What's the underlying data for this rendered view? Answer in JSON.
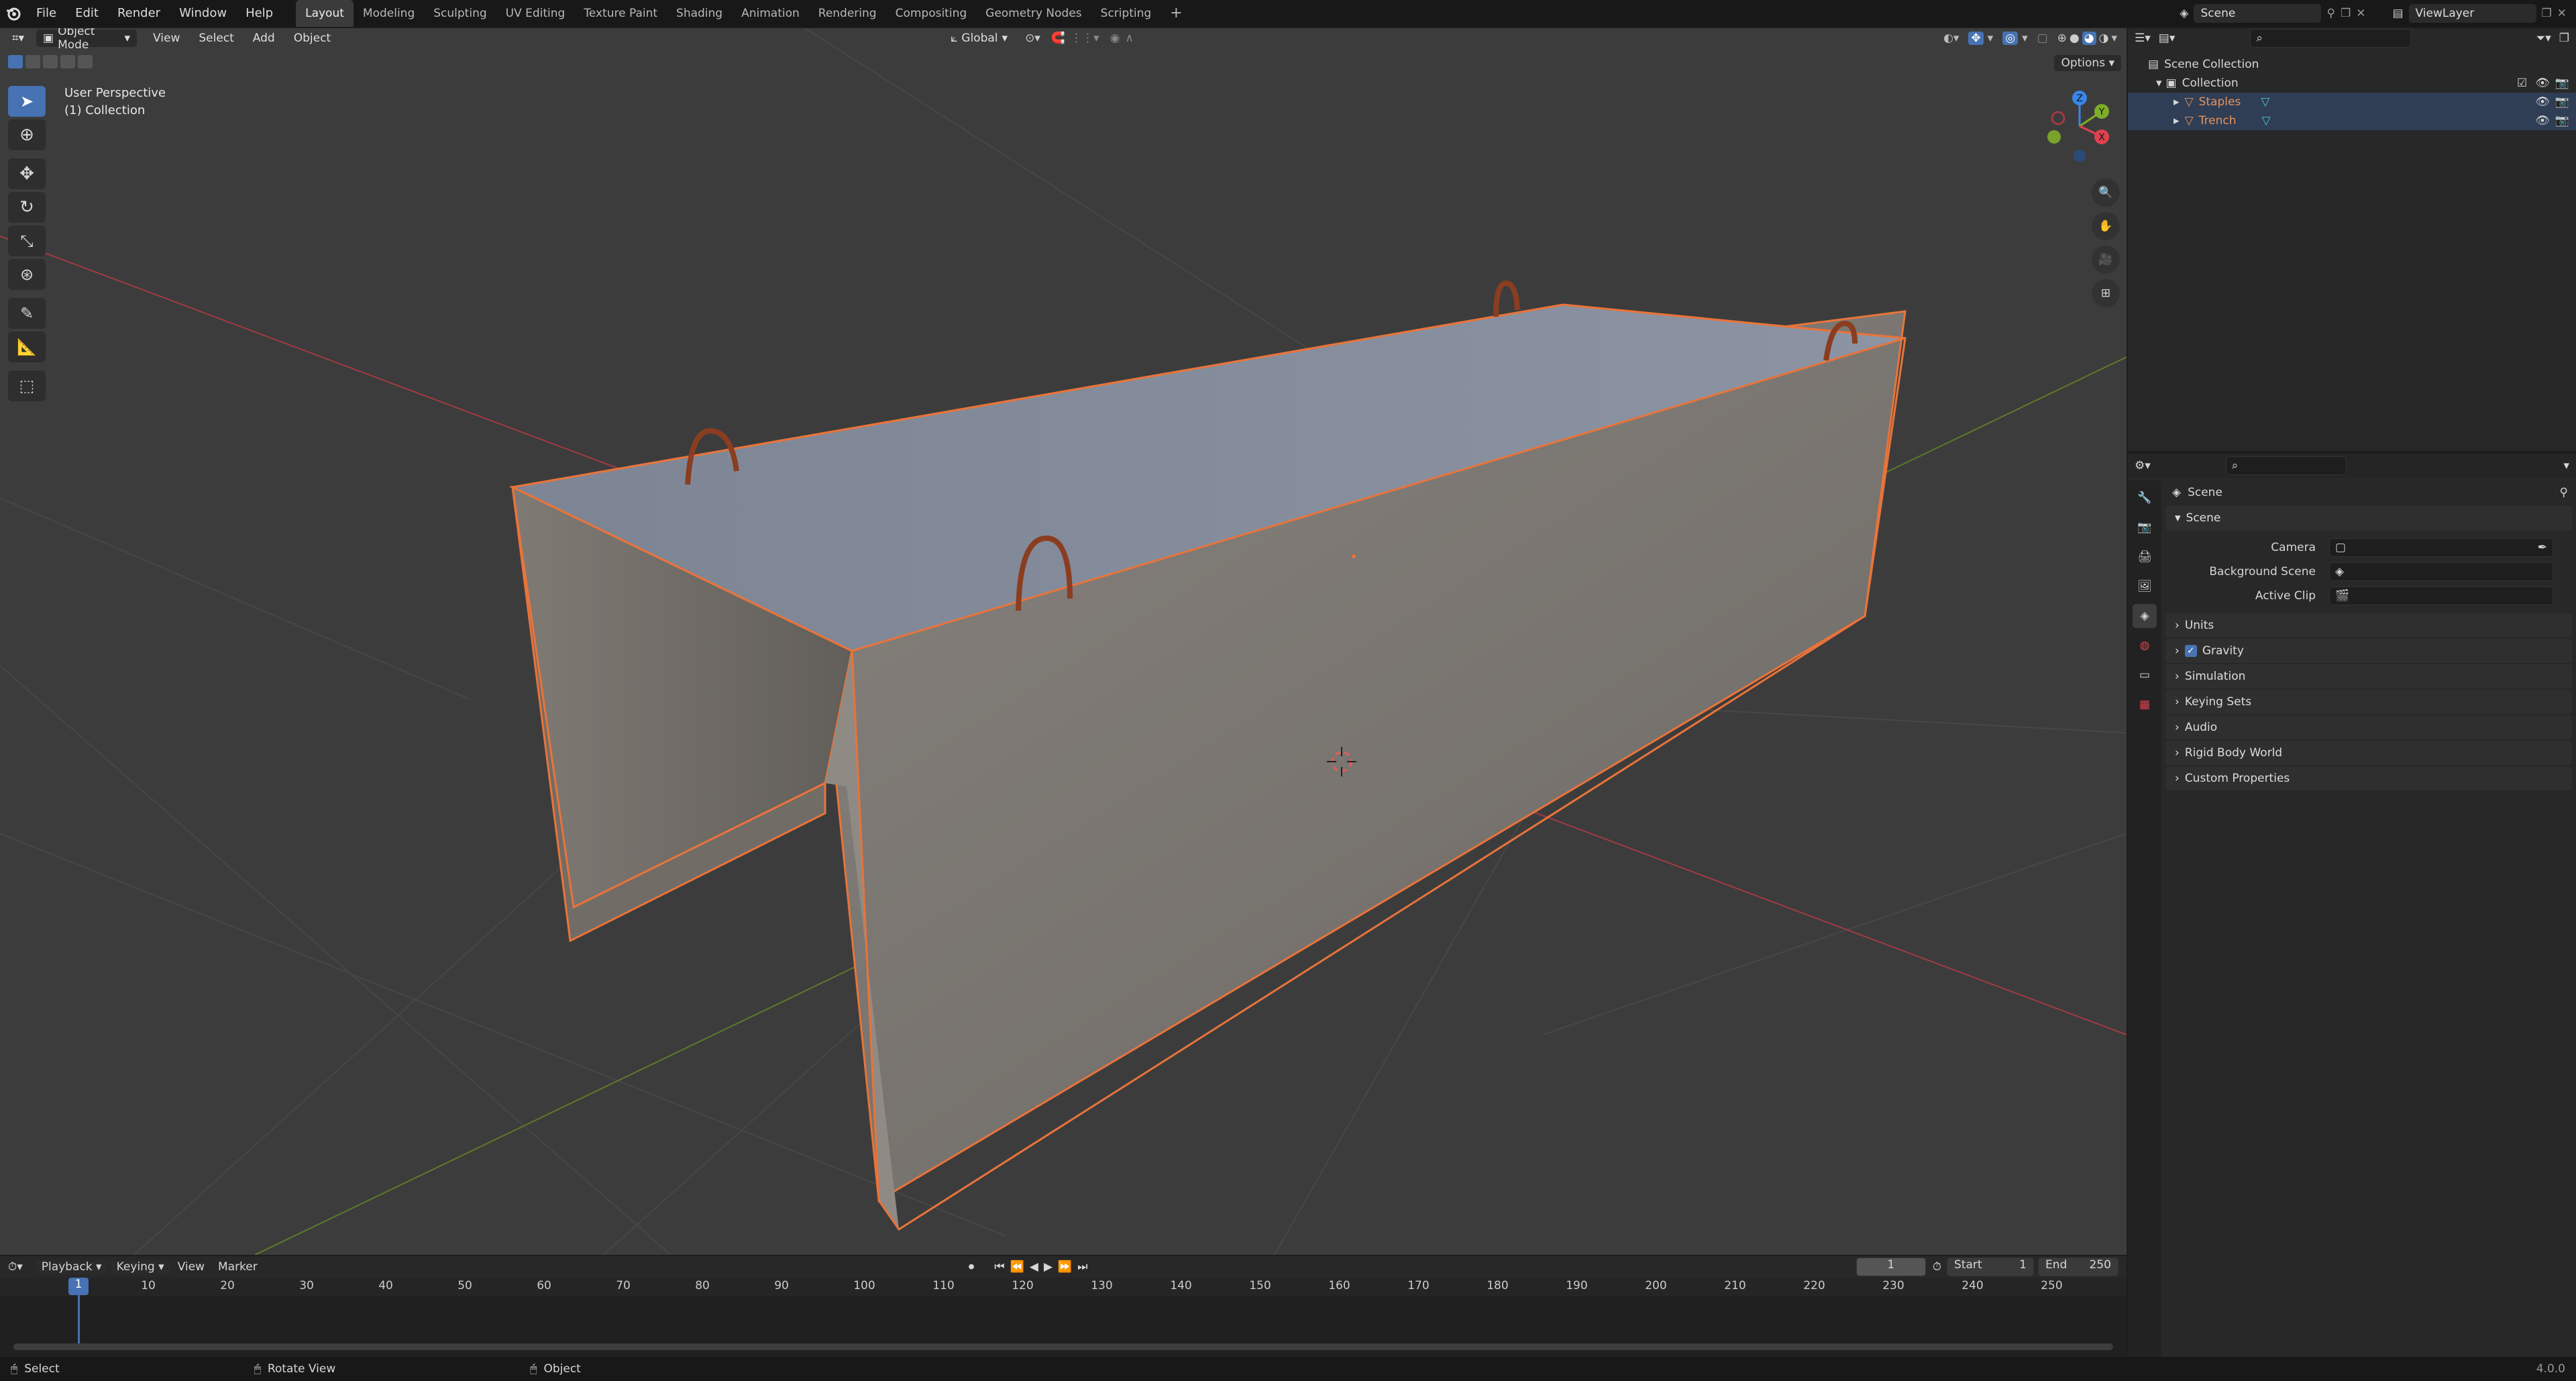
{
  "topbar": {
    "menus": [
      "File",
      "Edit",
      "Render",
      "Window",
      "Help"
    ],
    "workspaces": [
      "Layout",
      "Modeling",
      "Sculpting",
      "UV Editing",
      "Texture Paint",
      "Shading",
      "Animation",
      "Rendering",
      "Compositing",
      "Geometry Nodes",
      "Scripting"
    ],
    "active_workspace": "Layout",
    "scene": "Scene",
    "view_layer": "ViewLayer"
  },
  "viewport": {
    "mode": "Object Mode",
    "menus": [
      "View",
      "Select",
      "Add",
      "Object"
    ],
    "orientation": "Global",
    "options_label": "Options",
    "perspective_label": "User Perspective",
    "collection_label": "(1) Collection",
    "gizmo_axes": {
      "x": "X",
      "y": "Y",
      "z": "Z"
    }
  },
  "outliner": {
    "root": "Scene Collection",
    "collection": "Collection",
    "objects": [
      "Staples",
      "Trench"
    ]
  },
  "properties": {
    "context": "Scene",
    "panel_scene": "Scene",
    "camera_label": "Camera",
    "background_label": "Background Scene",
    "clip_label": "Active Clip",
    "panels": [
      "Units",
      "Gravity",
      "Simulation",
      "Keying Sets",
      "Audio",
      "Rigid Body World",
      "Custom Properties"
    ],
    "gravity_checked": true
  },
  "timeline": {
    "menus": [
      "Playback",
      "Keying",
      "View",
      "Marker"
    ],
    "current_frame": "1",
    "start_label": "Start",
    "start_value": "1",
    "end_label": "End",
    "end_value": "250",
    "ticks": [
      "1",
      "10",
      "20",
      "30",
      "40",
      "50",
      "60",
      "70",
      "80",
      "90",
      "100",
      "110",
      "120",
      "130",
      "140",
      "150",
      "160",
      "170",
      "180",
      "190",
      "200",
      "210",
      "220",
      "230",
      "240",
      "250"
    ]
  },
  "statusbar": {
    "select": "Select",
    "rotate": "Rotate View",
    "object": "Object",
    "version": "4.0.0"
  },
  "colors": {
    "accent": "#4772b3",
    "selection_outline": "#e8743b",
    "object_text": "#e8935a",
    "x_axis": "#e0414f",
    "y_axis": "#7fae29",
    "z_axis": "#3a86e8"
  }
}
